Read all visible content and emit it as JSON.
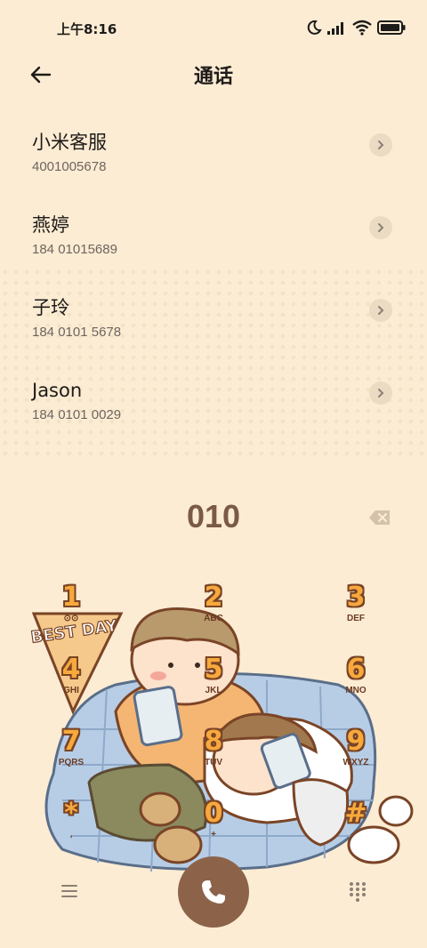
{
  "status_bar": {
    "time": "上午8:16"
  },
  "header": {
    "title": "通话"
  },
  "contacts": [
    {
      "name": "小米客服",
      "number": "4001005678"
    },
    {
      "name": "燕婷",
      "number": "184 01015689"
    },
    {
      "name": "子玲",
      "number": "184 0101 5678"
    },
    {
      "name": "Jason",
      "number": "184 0101 0029"
    }
  ],
  "dialer": {
    "input": "010"
  },
  "illustration": {
    "sign_text": "BEST DAY"
  },
  "keypad": [
    {
      "digit": "1",
      "letters": ""
    },
    {
      "digit": "2",
      "letters": "ABC"
    },
    {
      "digit": "3",
      "letters": "DEF"
    },
    {
      "digit": "4",
      "letters": "GHI"
    },
    {
      "digit": "5",
      "letters": "JKL"
    },
    {
      "digit": "6",
      "letters": "MNO"
    },
    {
      "digit": "7",
      "letters": "PQRS"
    },
    {
      "digit": "8",
      "letters": "TUV"
    },
    {
      "digit": "9",
      "letters": "WXYZ"
    },
    {
      "digit": "*",
      "letters": ","
    },
    {
      "digit": "0",
      "letters": "+"
    },
    {
      "digit": "#",
      "letters": ""
    }
  ],
  "colors": {
    "background": "#fbecd3",
    "accent": "#8c6349",
    "digit": "#f7a93c"
  }
}
